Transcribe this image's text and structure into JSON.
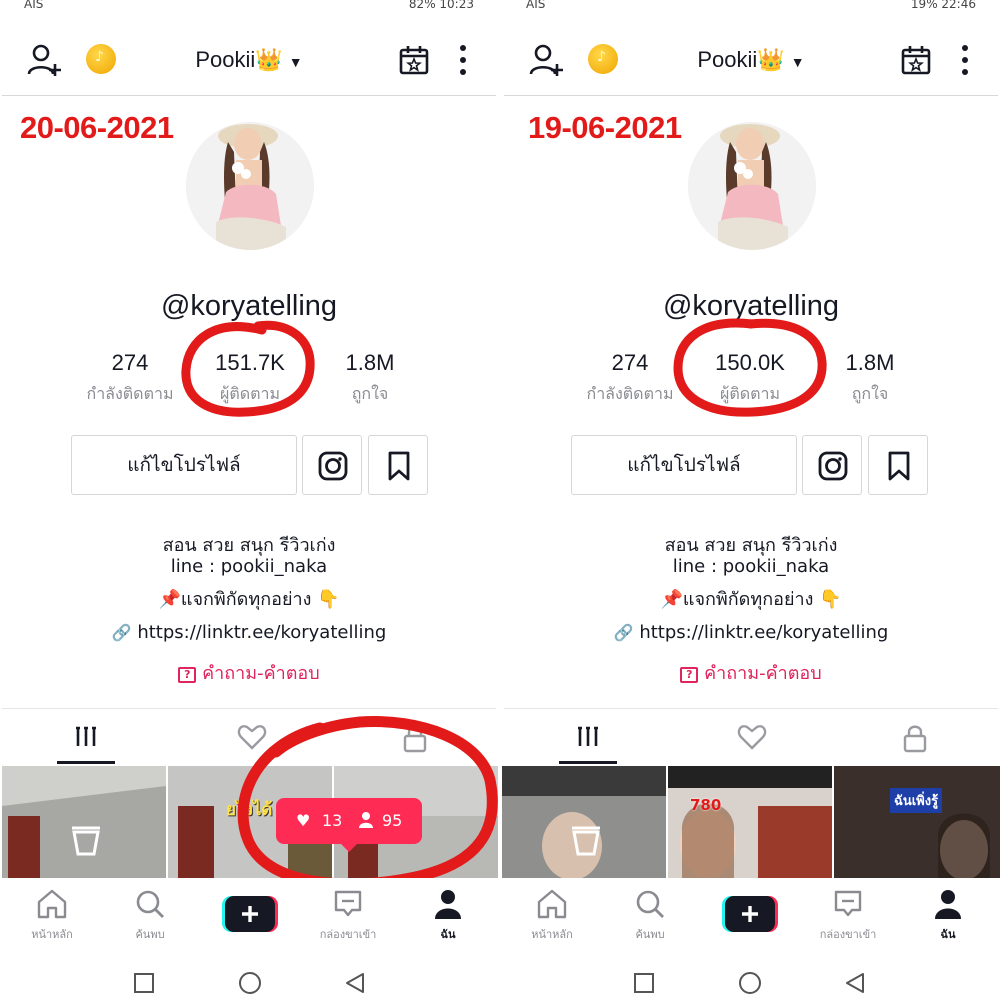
{
  "colors": {
    "accent": "#fe2c55",
    "annotation_red": "#e21a1a",
    "link_pink": "#e0245e",
    "muted": "#8a8b91"
  },
  "panels": [
    {
      "status": {
        "left": "AIS",
        "right": "82%  10:23"
      },
      "username": "Pookii👑",
      "date_annotation": "20-06-2021",
      "handle": "@koryatelling",
      "stats": [
        {
          "value": "274",
          "label": "กำลังติดตาม"
        },
        {
          "value": "151.7K",
          "label": "ผู้ติดตาม"
        },
        {
          "value": "1.8M",
          "label": "ถูกใจ"
        }
      ],
      "edit_profile": "แก้ไขโปรไฟล์",
      "bio": [
        "สอน สวย สนุก รีวิวเก่ง",
        "line : pookii_naka",
        "📌แจกพิกัดทุกอย่าง 👇"
      ],
      "link": "https://linktr.ee/koryatelling",
      "qa": "คำถาม-คำตอบ",
      "notification": {
        "likes": "13",
        "followers": "95"
      },
      "grid_texts": [
        "ยไงได้"
      ],
      "nav": {
        "home": "หน้าหลัก",
        "discover": "ค้นพบ",
        "inbox": "กล่องขาเข้า",
        "me": "ฉัน"
      }
    },
    {
      "status": {
        "left": "AIS",
        "right": "19%  22:46"
      },
      "username": "Pookii👑",
      "date_annotation": "19-06-2021",
      "handle": "@koryatelling",
      "stats": [
        {
          "value": "274",
          "label": "กำลังติดตาม"
        },
        {
          "value": "150.0K",
          "label": "ผู้ติดตาม"
        },
        {
          "value": "1.8M",
          "label": "ถูกใจ"
        }
      ],
      "edit_profile": "แก้ไขโปรไฟล์",
      "bio": [
        "สอน สวย สนุก รีวิวเก่ง",
        "line : pookii_naka",
        "📌แจกพิกัดทุกอย่าง 👇"
      ],
      "link": "https://linktr.ee/koryatelling",
      "qa": "คำถาม-คำตอบ",
      "grid_texts": [
        "780",
        "ฉันเพิ่งรู้"
      ],
      "nav": {
        "home": "หน้าหลัก",
        "discover": "ค้นพบ",
        "inbox": "กล่องขาเข้า",
        "me": "ฉัน"
      }
    }
  ]
}
